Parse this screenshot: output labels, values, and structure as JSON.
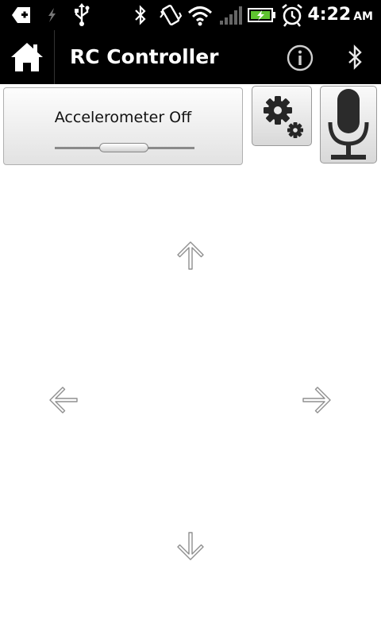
{
  "status_bar": {
    "time": "4:22",
    "ampm": "AM",
    "icons": [
      "add-notification-icon",
      "lightning-icon",
      "usb-icon",
      "bluetooth-icon",
      "vibrate-icon",
      "wifi-icon",
      "signal-icon",
      "battery-charging-icon",
      "alarm-icon"
    ]
  },
  "action_bar": {
    "title": "RC Controller",
    "icons": [
      "home-icon",
      "info-icon",
      "bluetooth-icon"
    ]
  },
  "accelerometer": {
    "label": "Accelerometer Off",
    "enabled": false
  },
  "buttons": {
    "settings_icon": "gears-icon",
    "mic_icon": "microphone-icon"
  },
  "dpad": [
    "arrow-up-icon",
    "arrow-left-icon",
    "arrow-right-icon",
    "arrow-down-icon"
  ],
  "colors": {
    "bar_background": "#000000",
    "page_background": "#ffffff",
    "battery_green": "#5fc330"
  }
}
